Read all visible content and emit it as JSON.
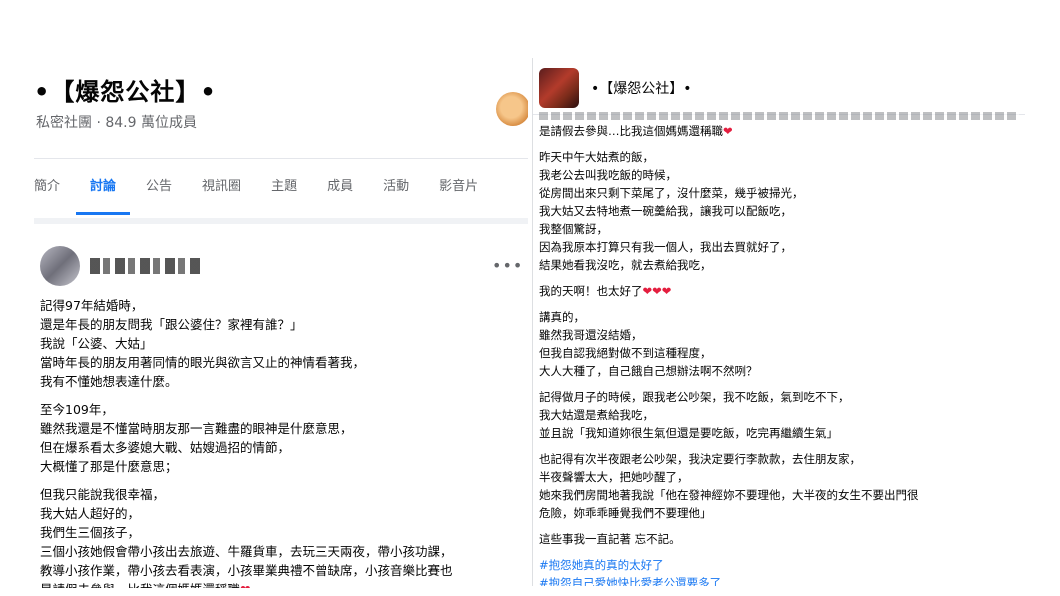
{
  "left": {
    "group_title": "•【爆怨公社】•",
    "group_meta": "私密社團 · 84.9 萬位成員",
    "tabs": [
      {
        "label": "簡介"
      },
      {
        "label": "討論"
      },
      {
        "label": "公告"
      },
      {
        "label": "視訊圈"
      },
      {
        "label": "主題"
      },
      {
        "label": "成員"
      },
      {
        "label": "活動"
      },
      {
        "label": "影音片"
      }
    ],
    "more_label": "•••",
    "paragraphs": [
      [
        "記得97年結婚時，",
        "還是年長的朋友問我「跟公婆住？家裡有誰？」",
        "我說「公婆、大姑」",
        "當時年長的朋友用著同情的眼光與欲言又止的神情看著我，",
        "我有不懂她想表達什麼。"
      ],
      [
        "至今109年，",
        "雖然我還是不懂當時朋友那一言難盡的眼神是什麼意思，",
        "但在爆系看太多婆媳大戰、姑嫂過招的情節，",
        "大概懂了那是什麼意思；"
      ],
      [
        "但我只能說我很幸福，",
        "我大姑人超好的，",
        "我們生三個孩子，",
        "三個小孩她假會帶小孩出去旅遊、牛羅貨車，去玩三天兩夜，帶小孩功課，",
        "教導小孩作業，帶小孩去看表演，小孩畢業典禮不曾缺席，小孩音樂比賽也",
        "是請假去參與…比我這個媽媽還稱職❤"
      ]
    ]
  },
  "right": {
    "group_title": "•【爆怨公社】•",
    "paragraphs": [
      [
        "是請假去參與…比我這個媽媽還稱職❤"
      ],
      [
        "昨天中午大姑煮的飯，",
        "我老公去叫我吃飯的時候，",
        "從房間出來只剩下菜尾了，沒什麼菜，幾乎被掃光，",
        "我大姑又去特地煮一碗羹給我，讓我可以配飯吃，",
        "我整個驚訝，",
        "因為我原本打算只有我一個人，我出去買就好了，",
        "結果她看我沒吃，就去煮給我吃，"
      ],
      [
        "我的天啊！也太好了❤❤❤"
      ],
      [
        "講真的，",
        "雖然我哥還沒結婚，",
        "但我自認我絕對做不到這種程度，",
        "大人大種了，自己餓自己想辦法啊不然咧？"
      ],
      [
        "記得做月子的時候，跟我老公吵架，我不吃飯，氣到吃不下，",
        "我大姑還是煮給我吃，",
        "並且說「我知道妳很生氣但還是要吃飯，吃完再繼續生氣」"
      ],
      [
        "也記得有次半夜跟老公吵架，我決定要行李款款，去住朋友家，",
        "半夜聲響太大，把她吵醒了，",
        "她來我們房間地著我說「他在發神經妳不要理他，大半夜的女生不要出門很",
        "危險，妳乖乖睡覺我們不要理他」"
      ],
      [
        "這些事我一直記著 忘不記。"
      ]
    ],
    "hashtags": [
      "#抱怨她真的真的太好了",
      "#抱怨自己愛她快比愛老公還要多了"
    ]
  }
}
